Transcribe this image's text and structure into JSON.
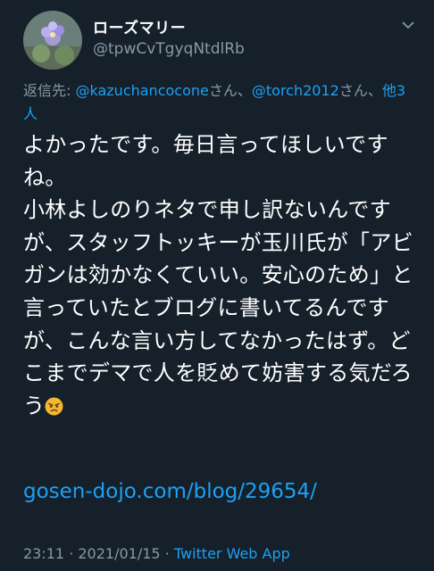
{
  "user": {
    "display_name": "ローズマリー",
    "handle": "@tpwCvTgyqNtdlRb"
  },
  "reply": {
    "prefix": "返信先: ",
    "mention1": "@kazuchancocone",
    "san1": "さん、",
    "mention2": "@torch2012",
    "san2": "さん、",
    "others": "他3人"
  },
  "tweet": {
    "text": "よかったです。毎日言ってほしいですね。\n小林よしのりネタで申し訳ないんですが、スタッフトッキーが玉川氏が「アビガンは効かなくていい。安心のため」と言っていたとブログに書いてるんですが、こんな言い方してなかったはず。どこまでデマで人を貶めて妨害する気だろう",
    "emoji": "angry-face-emoji",
    "link": "gosen-dojo.com/blog/29654/"
  },
  "meta": {
    "time": "23:11",
    "sep1": " · ",
    "date": "2021/01/15",
    "sep2": " · ",
    "app": "Twitter Web App"
  },
  "icons": {
    "menu": "chevron-down-icon"
  },
  "colors": {
    "background": "#15202b",
    "secondary_text": "#8899a6",
    "link": "#1da1f2"
  }
}
